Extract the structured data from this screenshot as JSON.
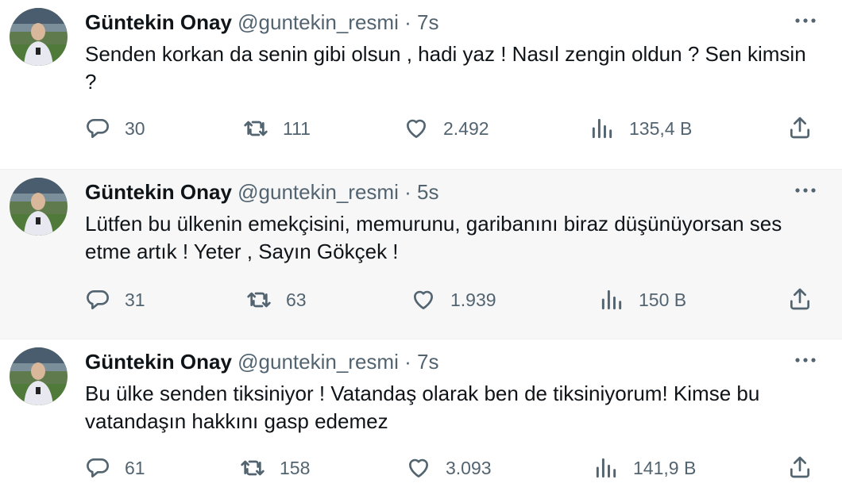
{
  "colors": {
    "muted": "#536471",
    "text": "#0f1419",
    "highlight_bg": "#f7f7f7"
  },
  "icons": [
    "reply-icon",
    "retweet-icon",
    "like-icon",
    "views-icon",
    "share-icon",
    "more-icon"
  ],
  "tweets": [
    {
      "name": "Güntekin Onay",
      "handle": "@guntekin_resmi",
      "sep": "·",
      "time": "7s",
      "text": "Senden korkan da senin gibi olsun , hadi yaz ! Nasıl zengin oldun ? Sen kimsin ?",
      "replies": "30",
      "retweets": "111",
      "likes": "2.492",
      "views": "135,4 B"
    },
    {
      "name": "Güntekin Onay",
      "handle": "@guntekin_resmi",
      "sep": "·",
      "time": "5s",
      "text": "Lütfen bu ülkenin emekçisini, memurunu, garibanını biraz düşünüyorsan ses etme artık ! Yeter , Sayın Gökçek !",
      "replies": "31",
      "retweets": "63",
      "likes": "1.939",
      "views": "150 B"
    },
    {
      "name": "Güntekin Onay",
      "handle": "@guntekin_resmi",
      "sep": "·",
      "time": "7s",
      "text": "Bu ülke senden tiksiniyor ! Vatandaş olarak ben de tiksiniyorum! Kimse bu vatandaşın hakkını gasp edemez",
      "replies": "61",
      "retweets": "158",
      "likes": "3.093",
      "views": "141,9 B"
    }
  ]
}
